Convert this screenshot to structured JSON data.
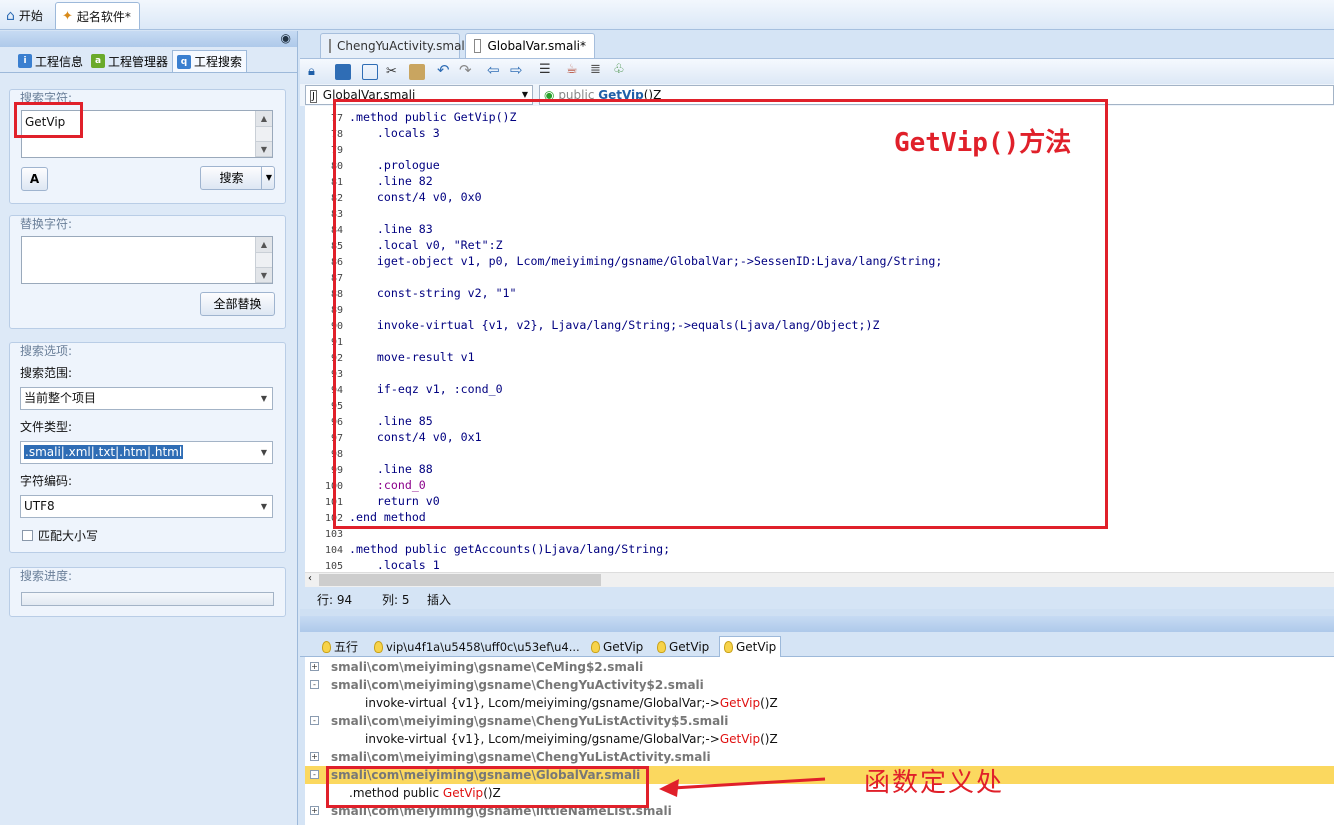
{
  "top_tabs": [
    {
      "label": "开始"
    },
    {
      "label": "起名软件*"
    }
  ],
  "left_tabs": [
    {
      "label": "工程信息"
    },
    {
      "label": "工程管理器"
    },
    {
      "label": "工程搜索"
    }
  ],
  "search": {
    "group_label": "搜索字符:",
    "value": "GetVip",
    "search_button": "搜索"
  },
  "replace": {
    "group_label": "替换字符:",
    "value": "",
    "replace_all_button": "全部替换"
  },
  "options": {
    "group_label": "搜索选项:",
    "scope_label": "搜索范围:",
    "scope_value": "当前整个项目",
    "filetype_label": "文件类型:",
    "filetype_value": ".smali|.xml|.txt|.htm|.html",
    "encoding_label": "字符编码:",
    "encoding_value": "UTF8",
    "match_case_label": "匹配大小写"
  },
  "progress": {
    "group_label": "搜索进度:",
    "fraction": 0
  },
  "editor_tabs": [
    {
      "label": "ChengYuActivity.smali*"
    },
    {
      "label": "GlobalVar.smali*"
    }
  ],
  "file_combo": "GlobalVar.smali",
  "method_combo": {
    "prefix": "public ",
    "name": "GetVip",
    "suffix": "()Z"
  },
  "code_lines": [
    {
      "n": "77",
      "t": ".method public GetVip()Z"
    },
    {
      "n": "78",
      "t": "    .locals 3"
    },
    {
      "n": "79",
      "t": ""
    },
    {
      "n": "80",
      "t": "    .prologue"
    },
    {
      "n": "81",
      "t": "    .line 82"
    },
    {
      "n": "82",
      "t": "    const/4 v0, 0x0"
    },
    {
      "n": "83",
      "t": ""
    },
    {
      "n": "84",
      "t": "    .line 83"
    },
    {
      "n": "85",
      "t": "    .local v0, \"Ret\":Z"
    },
    {
      "n": "86",
      "t": "    iget-object v1, p0, Lcom/meiyiming/gsname/GlobalVar;->SessenID:Ljava/lang/String;"
    },
    {
      "n": "87",
      "t": ""
    },
    {
      "n": "88",
      "t": "    const-string v2, \"1\""
    },
    {
      "n": "89",
      "t": ""
    },
    {
      "n": "90",
      "t": "    invoke-virtual {v1, v2}, Ljava/lang/String;->equals(Ljava/lang/Object;)Z"
    },
    {
      "n": "91",
      "t": ""
    },
    {
      "n": "92",
      "t": "    move-result v1"
    },
    {
      "n": "93",
      "t": ""
    },
    {
      "n": "94",
      "t": "    if-eqz v1, :cond_0"
    },
    {
      "n": "95",
      "t": ""
    },
    {
      "n": "96",
      "t": "    .line 85"
    },
    {
      "n": "97",
      "t": "    const/4 v0, 0x1"
    },
    {
      "n": "98",
      "t": ""
    },
    {
      "n": "99",
      "t": "    .line 88"
    },
    {
      "n": "100",
      "t": "    :cond_0"
    },
    {
      "n": "101",
      "t": "    return v0"
    },
    {
      "n": "102",
      "t": ".end method"
    },
    {
      "n": "103",
      "t": ""
    },
    {
      "n": "104",
      "t": ".method public getAccounts()Ljava/lang/String;"
    },
    {
      "n": "105",
      "t": "    .locals 1"
    }
  ],
  "annotation_method": "GetVip()方法",
  "annotation_definition": "函数定义处",
  "status": {
    "row": "行: 94",
    "col": "列: 5",
    "mode": "插入"
  },
  "result_tabs": [
    {
      "label": "五行"
    },
    {
      "label": "vip\\u4f1a\\u5458\\uff0c\\u53ef\\u4..."
    },
    {
      "label": "GetVip"
    },
    {
      "label": "GetVip"
    },
    {
      "label": "GetVip"
    }
  ],
  "results": [
    {
      "kind": "file",
      "text": "smali\\com\\meiyiming\\gsname\\CeMing$2.smali",
      "fold": "+"
    },
    {
      "kind": "file",
      "text": "smali\\com\\meiyiming\\gsname\\ChengYuActivity$2.smali",
      "fold": "-"
    },
    {
      "kind": "match",
      "pre": "invoke-virtual {v1}, Lcom/meiyiming/gsname/GlobalVar;->",
      "hit": "GetVip",
      "post": "()Z"
    },
    {
      "kind": "file",
      "text": "smali\\com\\meiyiming\\gsname\\ChengYuListActivity$5.smali",
      "fold": "-"
    },
    {
      "kind": "match",
      "pre": "invoke-virtual {v1}, Lcom/meiyiming/gsname/GlobalVar;->",
      "hit": "GetVip",
      "post": "()Z"
    },
    {
      "kind": "file",
      "text": "smali\\com\\meiyiming\\gsname\\ChengYuListActivity.smali",
      "fold": "+"
    },
    {
      "kind": "file",
      "text": "smali\\com\\meiyiming\\gsname\\GlobalVar.smali",
      "fold": "-",
      "highlight": true
    },
    {
      "kind": "match",
      "pre": ".method public ",
      "hit": "GetVip",
      "post": "()Z"
    },
    {
      "kind": "file",
      "text": "smali\\com\\meiyiming\\gsname\\littleNameList.smali",
      "fold": "+"
    }
  ],
  "colors": {
    "annotation": "#e0202a",
    "highlight_row": "#fbd85f",
    "accent": "#2f6db5"
  }
}
